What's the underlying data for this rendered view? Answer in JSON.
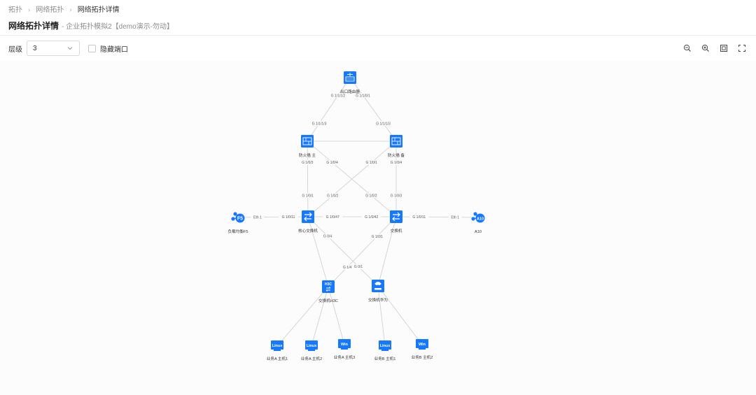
{
  "breadcrumb": [
    "拓扑",
    "网络拓扑",
    "网络拓扑详情"
  ],
  "page": {
    "title": "网络拓扑详情",
    "subtitle": "- 企业拓扑模拟2【demo演示-勿动】"
  },
  "toolbar": {
    "level_label": "层级",
    "level_value": "3",
    "hide_ports_label": "隐藏端口",
    "tools": [
      "zoom-out-icon",
      "zoom-in-icon",
      "fit-view-icon",
      "fullscreen-icon"
    ]
  },
  "colors": {
    "accent": "#1677ff",
    "edge": "#cccccc",
    "label": "#555555"
  },
  "topology": {
    "nodes": [
      {
        "id": "router",
        "label": "出口路由器",
        "icon": "router-icon"
      },
      {
        "id": "fw1",
        "label": "防火墙 主",
        "icon": "firewall-icon"
      },
      {
        "id": "fw2",
        "label": "防火墙 备",
        "icon": "firewall-icon"
      },
      {
        "id": "f5",
        "label": "负载均衡F5",
        "icon": "load-balancer-f5-icon",
        "badge": "F5"
      },
      {
        "id": "core",
        "label": "核心交换机",
        "icon": "switch-icon"
      },
      {
        "id": "sw2",
        "label": "交换机",
        "icon": "switch-icon"
      },
      {
        "id": "a10",
        "label": "A10",
        "icon": "load-balancer-a10-icon",
        "badge": "A10"
      },
      {
        "id": "h3c",
        "label": "交换机H3C",
        "icon": "h3c-switch-icon",
        "badge": "H3C"
      },
      {
        "id": "huawei",
        "label": "交换机华为",
        "icon": "huawei-switch-icon"
      },
      {
        "id": "hostA1",
        "label": "业务A 主机1",
        "icon": "linux-host-icon",
        "badge": "Linux"
      },
      {
        "id": "hostA2",
        "label": "业务A 主机2",
        "icon": "linux-host-icon",
        "badge": "Linux"
      },
      {
        "id": "hostA3",
        "label": "业务A 主机3",
        "icon": "windows-host-icon",
        "badge": "Win"
      },
      {
        "id": "hostB1",
        "label": "业务B 主机1",
        "icon": "linux-host-icon",
        "badge": "Linux"
      },
      {
        "id": "hostB2",
        "label": "业务B 主机2",
        "icon": "windows-host-icon",
        "badge": "Win"
      }
    ],
    "edges": [
      {
        "from": "router",
        "to": "fw1",
        "from_port": "G 1/1/1/2",
        "to_port": "G 1/1/1/3"
      },
      {
        "from": "router",
        "to": "fw2",
        "from_port": "G 1/1/0/1",
        "to_port": "G 1/1/1/3"
      },
      {
        "from": "fw1",
        "to": "fw2",
        "from_port": "",
        "to_port": ""
      },
      {
        "from": "fw1",
        "to": "core",
        "from_port": "G 1/0/3",
        "to_port": "G 1/0/1"
      },
      {
        "from": "fw1",
        "to": "sw2",
        "from_port": "G 1/0/4",
        "to_port": "G 1/0/2"
      },
      {
        "from": "fw2",
        "to": "core",
        "from_port": "G 1/0/1",
        "to_port": "G 1/0/2"
      },
      {
        "from": "fw2",
        "to": "sw2",
        "from_port": "G 1/0/4",
        "to_port": "G 1/0/3"
      },
      {
        "from": "f5",
        "to": "core",
        "from_port": "Eth 1",
        "to_port": "G 1/0/11"
      },
      {
        "from": "core",
        "to": "sw2",
        "from_port": "G 1/0/47",
        "to_port": "G 1/0/42"
      },
      {
        "from": "sw2",
        "to": "a10",
        "from_port": "G 1/0/11",
        "to_port": "Eth 1"
      },
      {
        "from": "core",
        "to": "h3c",
        "from_port": "",
        "to_port": ""
      },
      {
        "from": "core",
        "to": "huawei",
        "from_port": "G 0/4",
        "to_port": "G 0/1"
      },
      {
        "from": "sw2",
        "to": "h3c",
        "from_port": "G 1/0/1",
        "to_port": "G 1/4"
      },
      {
        "from": "sw2",
        "to": "huawei",
        "from_port": "",
        "to_port": ""
      },
      {
        "from": "h3c",
        "to": "hostA1",
        "from_port": "",
        "to_port": ""
      },
      {
        "from": "h3c",
        "to": "hostA2",
        "from_port": "",
        "to_port": ""
      },
      {
        "from": "h3c",
        "to": "hostA3",
        "from_port": "",
        "to_port": ""
      },
      {
        "from": "huawei",
        "to": "hostB1",
        "from_port": "",
        "to_port": ""
      },
      {
        "from": "huawei",
        "to": "hostB2",
        "from_port": "",
        "to_port": ""
      }
    ]
  }
}
